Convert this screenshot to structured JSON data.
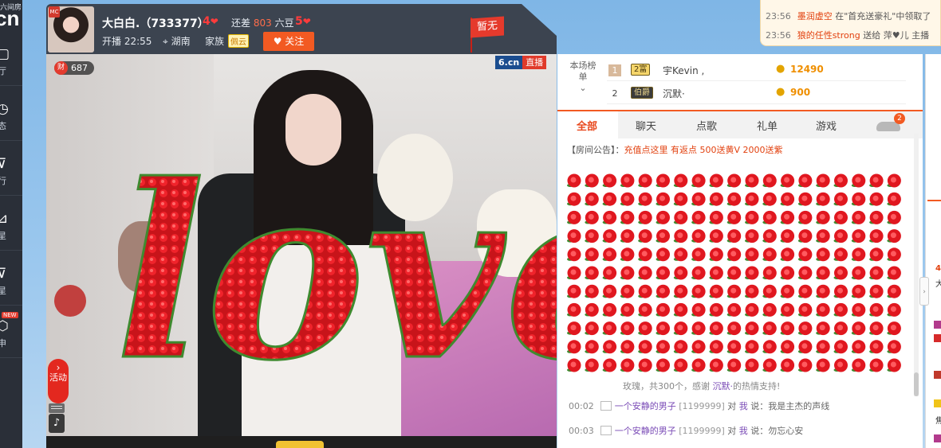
{
  "nav": {
    "logo_small": "六间房",
    "logo_big": "cn",
    "items": [
      {
        "label": "厅",
        "glyph": "▢"
      },
      {
        "label": "态",
        "glyph": "◷"
      },
      {
        "label": "行",
        "glyph": "⊽"
      },
      {
        "label": "星",
        "glyph": "⊿"
      },
      {
        "label": "星",
        "glyph": "⊽"
      },
      {
        "label": "申",
        "glyph": "⬡",
        "badge": "NEW"
      }
    ]
  },
  "host": {
    "avatar_badge": "MC",
    "name": "大白白.（733377）",
    "level_current": "4",
    "gap_label": "还差",
    "gap_value": "803",
    "gap_unit": "六豆",
    "level_next": "5",
    "start_time": "开播 22:55",
    "location": "湖南",
    "family_label": "家族",
    "family_name": "佩云",
    "follow_label": "关注",
    "flag_label": "暂无"
  },
  "video": {
    "fortune_icon": "财",
    "fortune_value": "687",
    "brand": "6.cn",
    "live_label": "直播",
    "activity_label": "活动",
    "overlay_word": "love"
  },
  "ranking": {
    "title": "本场榜单",
    "rows": [
      {
        "rank": "1",
        "badge": "2富",
        "name": "宇Kevin ,",
        "score": "12490"
      },
      {
        "rank": "2",
        "badge": "伯爵",
        "name": "沉默·",
        "score": "900"
      }
    ]
  },
  "tabs": [
    "全部",
    "聊天",
    "点歌",
    "礼单",
    "游戏"
  ],
  "car_badge": "2",
  "notice": {
    "label": "【房间公告】：",
    "text": "充值点这里 有返点 500送黄V 2000送紫"
  },
  "gift_message": {
    "prefix": "玫瑰，共300个，感谢",
    "user": "沉默·",
    "suffix": "的热情支持!"
  },
  "chat": [
    {
      "time": "00:02",
      "user": "一个安静的男子",
      "uid": "[1199999]",
      "mid": "对",
      "target": "我",
      "verb": "说：",
      "text": "我是主杰的声线"
    },
    {
      "time": "00:03",
      "user": "一个安静的男子",
      "uid": "[1199999]",
      "mid": "对",
      "target": "我",
      "verb": "说：",
      "text": "勿忘心安"
    }
  ],
  "toasts": [
    {
      "time": "23:56",
      "user": "墨润虚空",
      "text": "在\"首充送豪礼\"中领取了"
    },
    {
      "time": "23:56",
      "user": "狼的任性strong",
      "text": "送给 萍♥儿 主播"
    }
  ],
  "farright": {
    "num": "4",
    "char1": "大",
    "char2": "焦"
  },
  "colors": {
    "accent": "#f25a22",
    "rose": "#e0171f",
    "nav_bg": "#2a2f38",
    "hostbar_bg": "#3c4450"
  }
}
